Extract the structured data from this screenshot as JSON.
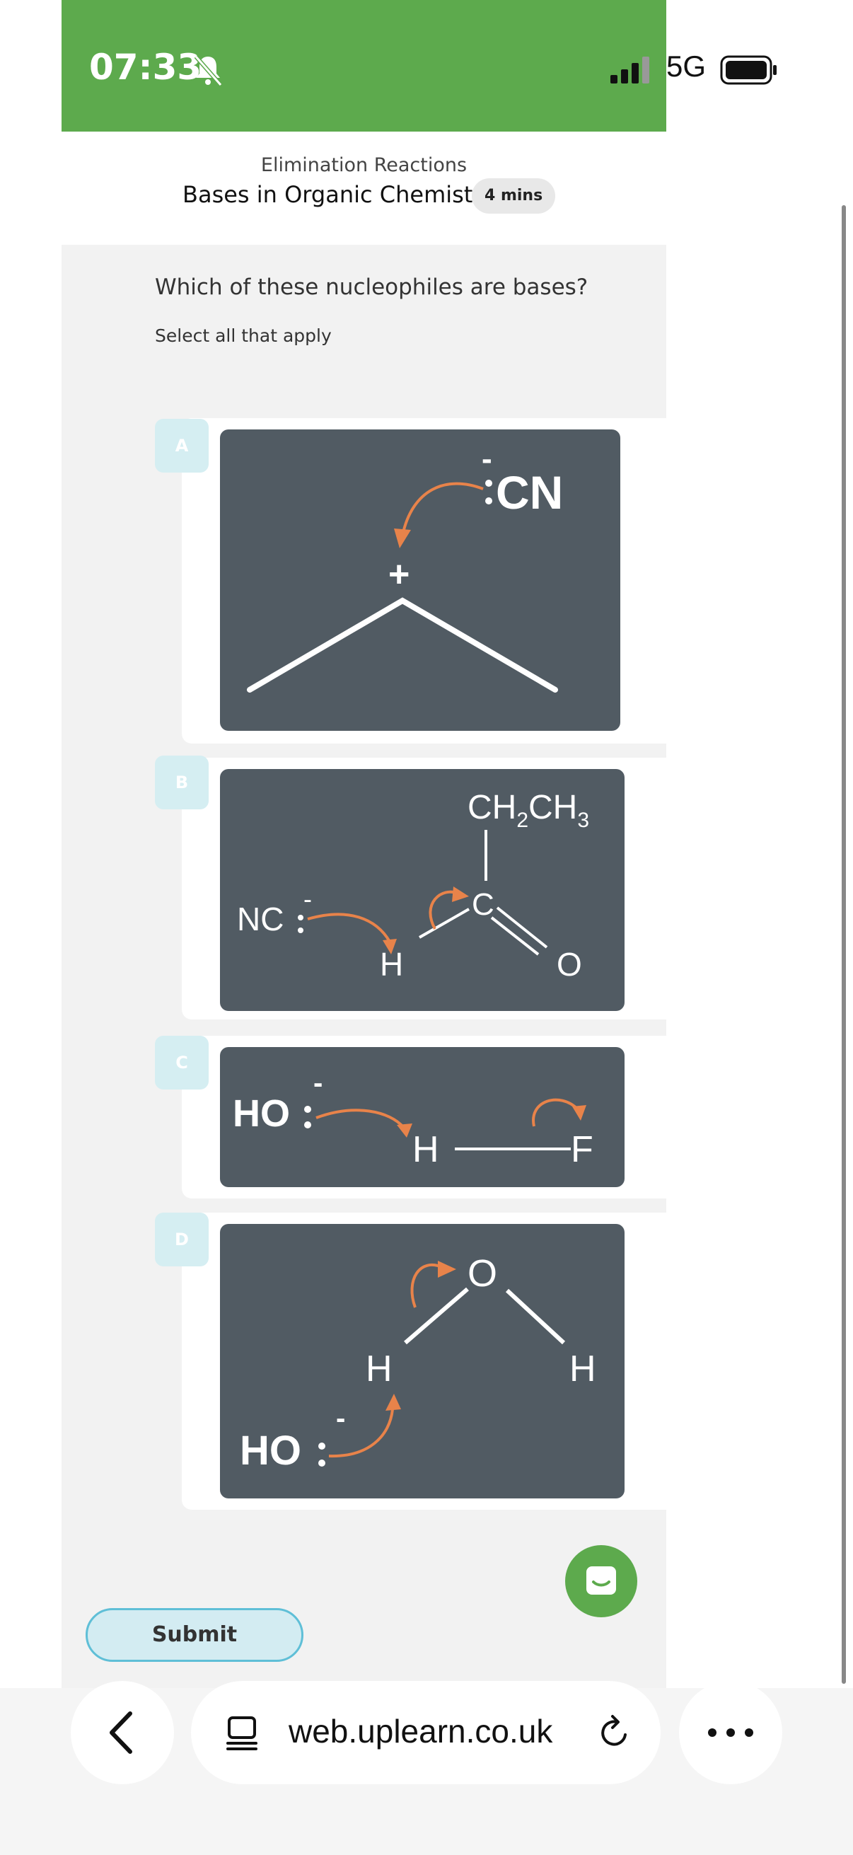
{
  "status_bar": {
    "time": "07:33",
    "network": "5G",
    "bg_color": "#5daa4d",
    "icons": [
      "bell-slash-icon",
      "signal-icon",
      "battery-icon"
    ]
  },
  "header": {
    "subtitle": "Elimination Reactions",
    "title": "Bases in Organic Chemistry",
    "badge": "4 mins"
  },
  "question": {
    "text": "Which of these nucleophiles are bases?",
    "hint": "Select all that apply"
  },
  "options": [
    {
      "letter": "A",
      "labels": {
        "anion": "CN",
        "charge_minus": "-",
        "charge_plus": "+"
      }
    },
    {
      "letter": "B",
      "labels": {
        "nucleophile": "NC",
        "charge": "-",
        "substituent": "CH",
        "sub1": "2",
        "substituent2": "CH",
        "sub2": "3",
        "carbon": "C",
        "hydrogen": "H",
        "oxygen": "O"
      }
    },
    {
      "letter": "C",
      "labels": {
        "nucleophile": "HO",
        "charge": "-",
        "hydrogen": "H",
        "fluorine": "F"
      }
    },
    {
      "letter": "D",
      "labels": {
        "oxygen": "O",
        "hydrogen_left": "H",
        "hydrogen_right": "H",
        "nucleophile": "HO",
        "charge": "-"
      }
    }
  ],
  "submit": {
    "label": "Submit"
  },
  "browser": {
    "url": "web.uplearn.co.uk",
    "icons": [
      "chevron-left-icon",
      "reader-icon",
      "reload-icon",
      "more-icon"
    ]
  },
  "colors": {
    "accent_green": "#5daa4d",
    "diagram_bg": "#515b63",
    "arrow_orange": "#e8834a",
    "option_letter_bg": "#d5eef2",
    "submit_border": "#5fbfd7"
  }
}
